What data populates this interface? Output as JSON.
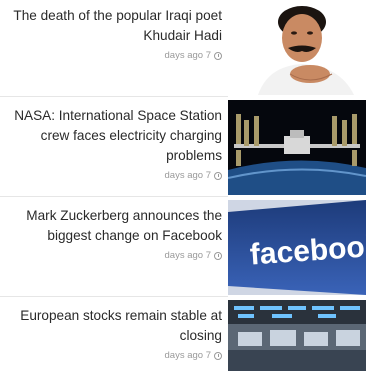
{
  "news": [
    {
      "title": "The death of the popular Iraqi poet Khudair Hadi",
      "time": "days ago 7",
      "image": "portrait-man-with-mustache"
    },
    {
      "title": "NASA: International Space Station crew faces electricity charging problems",
      "time": "days ago 7",
      "image": "international-space-station"
    },
    {
      "title": "Mark Zuckerberg announces the biggest change on Facebook",
      "time": "days ago 7",
      "image": "facebook-logo-sign"
    },
    {
      "title": "European stocks remain stable at closing",
      "time": "days ago 7",
      "image": "stock-exchange-trading-floor"
    }
  ],
  "colors": {
    "title": "#2a2a2a",
    "meta": "#9a9a9a",
    "facebook_blue": "#2b4f9e",
    "divider": "#e6e6e6"
  }
}
